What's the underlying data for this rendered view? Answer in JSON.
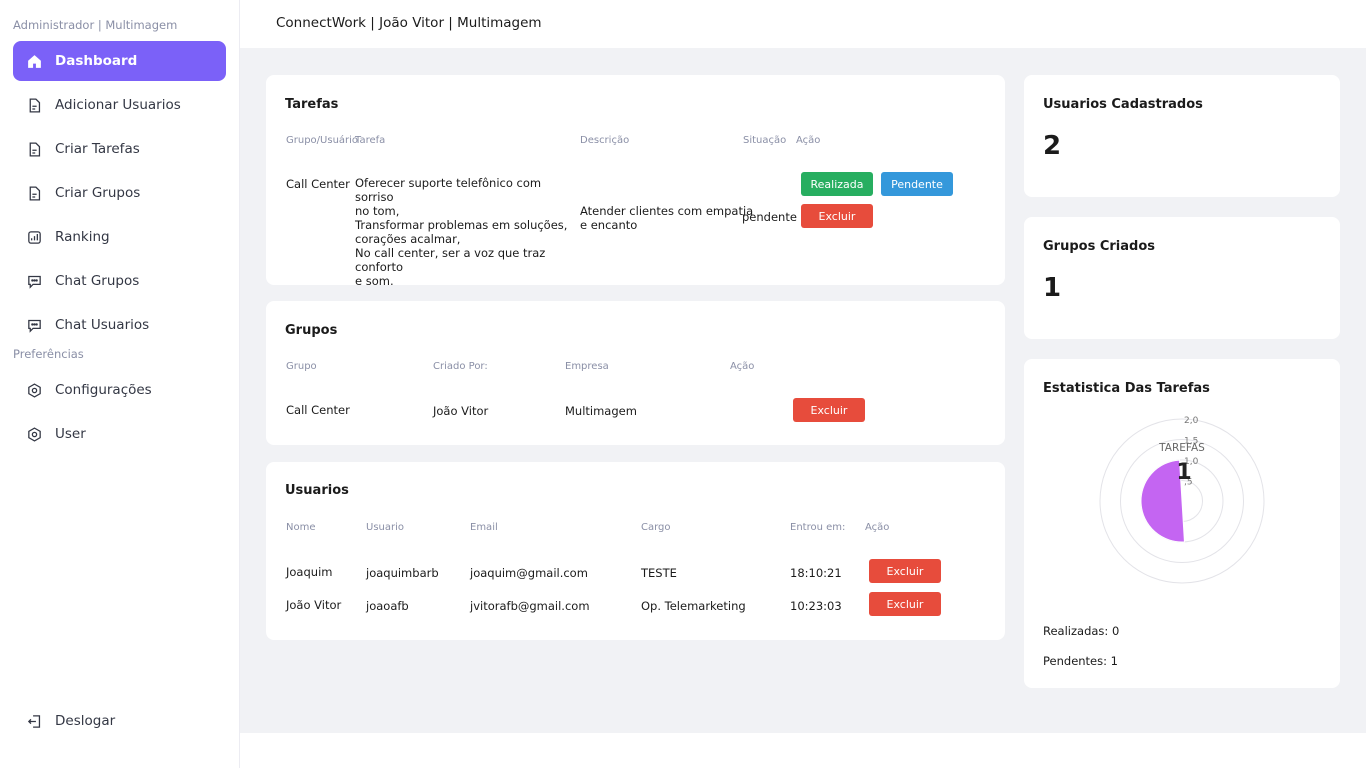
{
  "sidebar": {
    "section_admin": "Administrador | Multimagem",
    "section_prefs": "Preferências",
    "items": [
      {
        "label": "Dashboard",
        "icon": "home-icon"
      },
      {
        "label": "Adicionar Usuarios",
        "icon": "document-icon"
      },
      {
        "label": "Criar Tarefas",
        "icon": "document-icon"
      },
      {
        "label": "Criar Grupos",
        "icon": "document-icon"
      },
      {
        "label": "Ranking",
        "icon": "bar-chart-icon"
      },
      {
        "label": "Chat Grupos",
        "icon": "chat-icon"
      },
      {
        "label": "Chat Usuarios",
        "icon": "chat-icon"
      }
    ],
    "pref_items": [
      {
        "label": "Configurações",
        "icon": "settings-icon"
      },
      {
        "label": "User",
        "icon": "settings-icon"
      }
    ],
    "logout": "Deslogar"
  },
  "header": {
    "title": "ConnectWork | João Vitor | Multimagem"
  },
  "tarefas": {
    "title": "Tarefas",
    "columns": [
      "Grupo/Usuário",
      "Tarefa",
      "Descrição",
      "Situação",
      "Ação"
    ],
    "row": {
      "grupo": "Call Center",
      "tarefa_lines": [
        "Oferecer suporte telefônico com sorriso",
        "no tom,",
        "Transformar problemas em soluções,",
        "corações acalmar,",
        "No call center, ser a voz que traz conforto",
        "e som."
      ],
      "descricao_lines": [
        "Atender clientes com empatia",
        "e encanto"
      ],
      "situacao": "pendente",
      "btn_realizada": "Realizada",
      "btn_pendente": "Pendente",
      "btn_excluir": "Excluir"
    }
  },
  "grupos": {
    "title": "Grupos",
    "columns": [
      "Grupo",
      "Criado Por:",
      "Empresa",
      "Ação"
    ],
    "row": {
      "grupo": "Call Center",
      "criado_por": "João Vitor",
      "empresa": "Multimagem",
      "btn_excluir": "Excluir"
    }
  },
  "usuarios": {
    "title": "Usuarios",
    "columns": [
      "Nome",
      "Usuario",
      "Email",
      "Cargo",
      "Entrou em:",
      "Ação"
    ],
    "rows": [
      {
        "nome": "Joaquim",
        "usuario": "joaquimbarb",
        "email": "joaquim@gmail.com",
        "cargo": "TESTE",
        "entrou": "18:10:21",
        "btn": "Excluir"
      },
      {
        "nome": "João Vitor",
        "usuario": "joaoafb",
        "email": "jvitorafb@gmail.com",
        "cargo": "Op. Telemarketing",
        "entrou": "10:23:03",
        "btn": "Excluir"
      }
    ]
  },
  "stats": {
    "usuarios_title": "Usuarios Cadastrados",
    "usuarios_value": "2",
    "grupos_title": "Grupos Criados",
    "grupos_value": "1",
    "tarefas_title": "Estatistica Das Tarefas",
    "realizadas": "Realizadas: 0",
    "pendentes": "Pendentes: 1"
  },
  "chart_data": {
    "type": "polar-area",
    "title": "TAREFAS",
    "categories": [
      "Realizadas",
      "Pendentes"
    ],
    "values": [
      0,
      1
    ],
    "center_label": "1",
    "r_ticks": [
      "2,0",
      "1,5",
      "1,0",
      ",5"
    ],
    "r_range": [
      0,
      2
    ],
    "colors": {
      "pendentes": "#c465f2"
    }
  },
  "colors": {
    "accent": "#7b61f8",
    "success": "#27ae60",
    "info": "#3498db",
    "danger": "#e74c3c",
    "background": "#f1f2f5"
  }
}
